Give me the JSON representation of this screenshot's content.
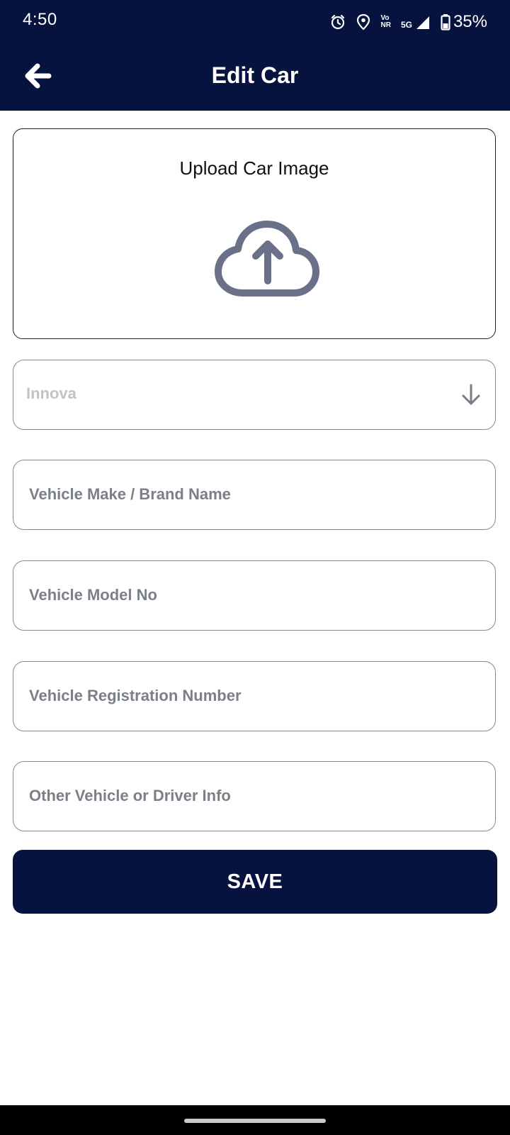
{
  "status_bar": {
    "time": "4:50",
    "network_top": "Vo",
    "network_bottom": "NR",
    "network_type": "5G",
    "battery": "35%",
    "icons": [
      "alarm-icon",
      "location-icon",
      "signal-icon",
      "battery-icon"
    ]
  },
  "header": {
    "title": "Edit Car",
    "back_icon": "arrow-left-icon"
  },
  "upload": {
    "title": "Upload Car Image",
    "icon": "cloud-upload-icon"
  },
  "form": {
    "car_type": {
      "value": "Innova",
      "icon": "arrow-down-icon"
    },
    "make": {
      "placeholder": "Vehicle Make / Brand Name",
      "value": ""
    },
    "model": {
      "placeholder": "Vehicle Model No",
      "value": ""
    },
    "registration": {
      "placeholder": "Vehicle Registration Number",
      "value": ""
    },
    "other_info": {
      "placeholder": "Other Vehicle or Driver Info",
      "value": ""
    }
  },
  "actions": {
    "save_label": "SAVE"
  },
  "colors": {
    "primary": "#07133f",
    "icon_gray": "#6b7089",
    "placeholder": "#7b7f88",
    "border": "#8a8a8a"
  }
}
